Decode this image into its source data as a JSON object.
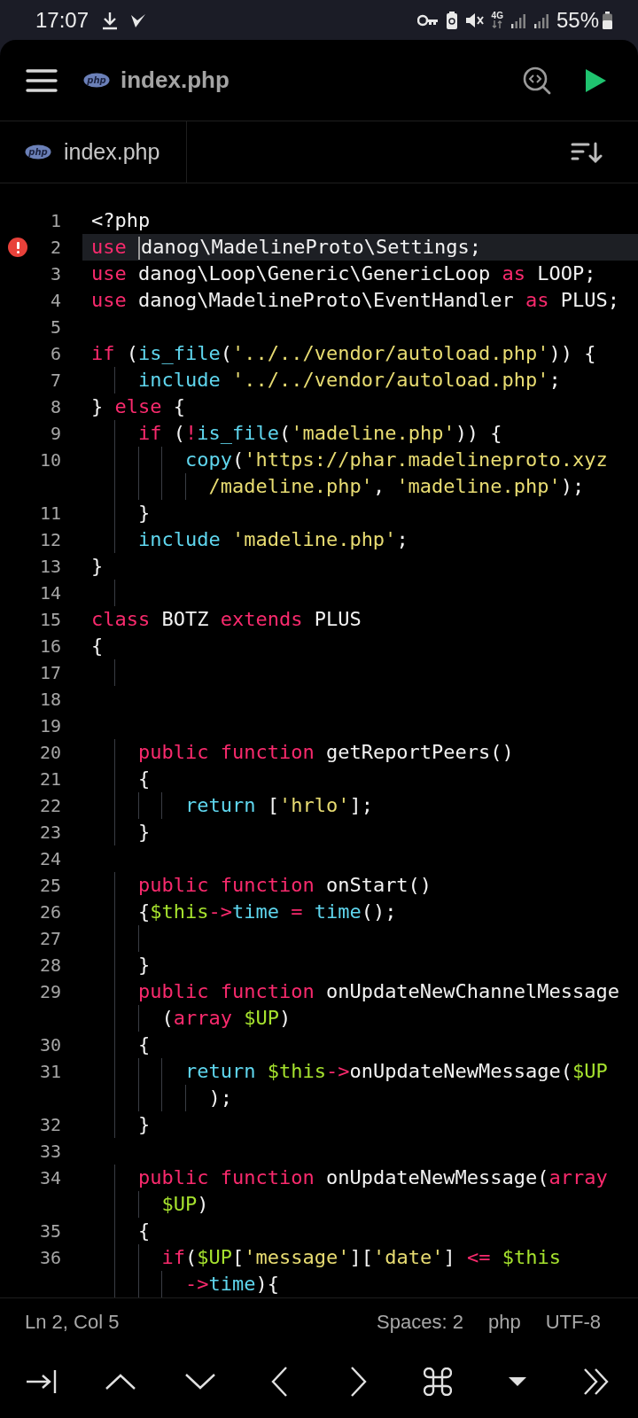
{
  "phone_status": {
    "time": "17:07",
    "network": "4G",
    "battery": "55%"
  },
  "toolbar": {
    "file_badge": "php",
    "title": "index.php"
  },
  "tabs": [
    {
      "badge": "php",
      "label": "index.php",
      "selected": true
    }
  ],
  "editor": {
    "lines": [
      {
        "number": "1",
        "rows": [
          {
            "tokens": [
              {
                "kind": "plain",
                "text": "<?php"
              }
            ]
          }
        ]
      },
      {
        "number": "2",
        "error": true,
        "current": true,
        "rows": [
          {
            "tokens": [
              {
                "kind": "keyword",
                "text": "use "
              },
              {
                "kind": "plain",
                "text": "danog\\MadelineProto\\Settings;",
                "cursor_before": true
              }
            ]
          }
        ]
      },
      {
        "number": "3",
        "rows": [
          {
            "tokens": [
              {
                "kind": "keyword",
                "text": "use "
              },
              {
                "kind": "plain",
                "text": "danog\\Loop\\Generic\\GenericLoop "
              },
              {
                "kind": "keyword",
                "text": "as"
              },
              {
                "kind": "plain",
                "text": " LOOP;"
              }
            ]
          }
        ]
      },
      {
        "number": "4",
        "rows": [
          {
            "tokens": [
              {
                "kind": "keyword",
                "text": "use "
              },
              {
                "kind": "plain",
                "text": "danog\\MadelineProto\\EventHandler "
              },
              {
                "kind": "keyword",
                "text": "as"
              },
              {
                "kind": "plain",
                "text": " PLUS;"
              }
            ]
          }
        ]
      },
      {
        "number": "5"
      },
      {
        "number": "6",
        "rows": [
          {
            "tokens": [
              {
                "kind": "keyword",
                "text": "if"
              },
              {
                "kind": "plain",
                "text": " ("
              },
              {
                "kind": "function",
                "text": "is_file"
              },
              {
                "kind": "plain",
                "text": "("
              },
              {
                "kind": "string",
                "text": "'../../vendor/autoload.php'"
              },
              {
                "kind": "plain",
                "text": ")) {"
              }
            ]
          }
        ]
      },
      {
        "number": "7",
        "rows": [
          {
            "indent": "    ",
            "tokens": [
              {
                "kind": "function",
                "text": "include"
              },
              {
                "kind": "string",
                "text": " '../../vendor/autoload.php'"
              },
              {
                "kind": "plain",
                "text": ";"
              }
            ]
          }
        ]
      },
      {
        "number": "8",
        "rows": [
          {
            "tokens": [
              {
                "kind": "plain",
                "text": "} "
              },
              {
                "kind": "keyword",
                "text": "else"
              },
              {
                "kind": "plain",
                "text": " {"
              }
            ]
          }
        ]
      },
      {
        "number": "9",
        "rows": [
          {
            "indent": "    ",
            "tokens": [
              {
                "kind": "keyword",
                "text": "if"
              },
              {
                "kind": "plain",
                "text": " ("
              },
              {
                "kind": "keyword",
                "text": "!"
              },
              {
                "kind": "function",
                "text": "is_file"
              },
              {
                "kind": "plain",
                "text": "("
              },
              {
                "kind": "string",
                "text": "'madeline.php'"
              },
              {
                "kind": "plain",
                "text": ")) {"
              }
            ]
          }
        ]
      },
      {
        "number": "10",
        "rows": [
          {
            "indent": "        ",
            "tokens": [
              {
                "kind": "function",
                "text": "copy"
              },
              {
                "kind": "plain",
                "text": "("
              },
              {
                "kind": "string",
                "text": "'https://phar.madelineproto.xyz"
              }
            ]
          },
          {
            "indent": "          ",
            "tokens": [
              {
                "kind": "string",
                "text": "/madeline.php'"
              },
              {
                "kind": "plain",
                "text": ", "
              },
              {
                "kind": "string",
                "text": "'madeline.php'"
              },
              {
                "kind": "plain",
                "text": ");"
              }
            ]
          }
        ]
      },
      {
        "number": "11",
        "rows": [
          {
            "indent": "    ",
            "tokens": [
              {
                "kind": "plain",
                "text": "}"
              }
            ]
          }
        ]
      },
      {
        "number": "12",
        "rows": [
          {
            "indent": "    ",
            "tokens": [
              {
                "kind": "function",
                "text": "include"
              },
              {
                "kind": "string",
                "text": " 'madeline.php'"
              },
              {
                "kind": "plain",
                "text": ";"
              }
            ]
          }
        ]
      },
      {
        "number": "13",
        "rows": [
          {
            "tokens": [
              {
                "kind": "plain",
                "text": "}"
              }
            ]
          }
        ]
      },
      {
        "number": "14",
        "rows": [
          {
            "indent": "    "
          }
        ]
      },
      {
        "number": "15",
        "rows": [
          {
            "tokens": [
              {
                "kind": "keyword",
                "text": "class"
              },
              {
                "kind": "plain",
                "text": " BOTZ "
              },
              {
                "kind": "keyword",
                "text": "extends"
              },
              {
                "kind": "plain",
                "text": " PLUS"
              }
            ]
          }
        ]
      },
      {
        "number": "16",
        "rows": [
          {
            "tokens": [
              {
                "kind": "plain",
                "text": "{"
              }
            ]
          }
        ]
      },
      {
        "number": "17",
        "rows": [
          {
            "indent": "    "
          }
        ]
      },
      {
        "number": "18"
      },
      {
        "number": "19"
      },
      {
        "number": "20",
        "rows": [
          {
            "indent": "    ",
            "tokens": [
              {
                "kind": "keyword",
                "text": "public function"
              },
              {
                "kind": "plain",
                "text": " getReportPeers()"
              }
            ]
          }
        ]
      },
      {
        "number": "21",
        "rows": [
          {
            "indent": "    ",
            "tokens": [
              {
                "kind": "plain",
                "text": "{"
              }
            ]
          }
        ]
      },
      {
        "number": "22",
        "rows": [
          {
            "indent": "        ",
            "tokens": [
              {
                "kind": "function",
                "text": "return"
              },
              {
                "kind": "plain",
                "text": " ["
              },
              {
                "kind": "string",
                "text": "'hrlo'"
              },
              {
                "kind": "plain",
                "text": "];"
              }
            ]
          }
        ]
      },
      {
        "number": "23",
        "rows": [
          {
            "indent": "    ",
            "tokens": [
              {
                "kind": "plain",
                "text": "}"
              }
            ]
          }
        ]
      },
      {
        "number": "24"
      },
      {
        "number": "25",
        "rows": [
          {
            "indent": "    ",
            "tokens": [
              {
                "kind": "keyword",
                "text": "public function"
              },
              {
                "kind": "plain",
                "text": " onStart()"
              }
            ]
          }
        ]
      },
      {
        "number": "26",
        "rows": [
          {
            "indent": "    ",
            "tokens": [
              {
                "kind": "plain",
                "text": "{"
              },
              {
                "kind": "variable",
                "text": "$this"
              },
              {
                "kind": "keyword",
                "text": "->"
              },
              {
                "kind": "function",
                "text": "time"
              },
              {
                "kind": "keyword",
                "text": " = "
              },
              {
                "kind": "function",
                "text": "time"
              },
              {
                "kind": "plain",
                "text": "();"
              }
            ]
          }
        ]
      },
      {
        "number": "27",
        "rows": [
          {
            "indent": "      "
          }
        ]
      },
      {
        "number": "28",
        "rows": [
          {
            "indent": "    ",
            "tokens": [
              {
                "kind": "plain",
                "text": "}"
              }
            ]
          }
        ]
      },
      {
        "number": "29",
        "rows": [
          {
            "indent": "    ",
            "tokens": [
              {
                "kind": "keyword",
                "text": "public function"
              },
              {
                "kind": "plain",
                "text": " onUpdateNewChannelMessage"
              }
            ]
          },
          {
            "indent": "      ",
            "tokens": [
              {
                "kind": "plain",
                "text": "("
              },
              {
                "kind": "keyword",
                "text": "array "
              },
              {
                "kind": "variable",
                "text": "$UP"
              },
              {
                "kind": "plain",
                "text": ")"
              }
            ]
          }
        ]
      },
      {
        "number": "30",
        "rows": [
          {
            "indent": "    ",
            "tokens": [
              {
                "kind": "plain",
                "text": "{"
              }
            ]
          }
        ]
      },
      {
        "number": "31",
        "rows": [
          {
            "indent": "        ",
            "tokens": [
              {
                "kind": "function",
                "text": "return "
              },
              {
                "kind": "variable",
                "text": "$this"
              },
              {
                "kind": "keyword",
                "text": "->"
              },
              {
                "kind": "plain",
                "text": "onUpdateNewMessage("
              },
              {
                "kind": "variable",
                "text": "$UP"
              }
            ]
          },
          {
            "indent": "          ",
            "tokens": [
              {
                "kind": "plain",
                "text": ");"
              }
            ]
          }
        ]
      },
      {
        "number": "32",
        "rows": [
          {
            "indent": "    ",
            "tokens": [
              {
                "kind": "plain",
                "text": "}"
              }
            ]
          }
        ]
      },
      {
        "number": "33"
      },
      {
        "number": "34",
        "rows": [
          {
            "indent": "    ",
            "tokens": [
              {
                "kind": "keyword",
                "text": "public function"
              },
              {
                "kind": "plain",
                "text": " onUpdateNewMessage("
              },
              {
                "kind": "keyword",
                "text": "array"
              }
            ]
          },
          {
            "indent": "      ",
            "tokens": [
              {
                "kind": "variable",
                "text": "$UP"
              },
              {
                "kind": "plain",
                "text": ")"
              }
            ]
          }
        ]
      },
      {
        "number": "35",
        "rows": [
          {
            "indent": "    ",
            "tokens": [
              {
                "kind": "plain",
                "text": "{"
              }
            ]
          }
        ]
      },
      {
        "number": "36",
        "rows": [
          {
            "indent": "      ",
            "tokens": [
              {
                "kind": "keyword",
                "text": "if"
              },
              {
                "kind": "plain",
                "text": "("
              },
              {
                "kind": "variable",
                "text": "$UP"
              },
              {
                "kind": "plain",
                "text": "["
              },
              {
                "kind": "string",
                "text": "'message'"
              },
              {
                "kind": "plain",
                "text": "]["
              },
              {
                "kind": "string",
                "text": "'date'"
              },
              {
                "kind": "plain",
                "text": "] "
              },
              {
                "kind": "keyword",
                "text": "<= "
              },
              {
                "kind": "variable",
                "text": "$this"
              }
            ]
          },
          {
            "indent": "        ",
            "tokens": [
              {
                "kind": "keyword",
                "text": "->"
              },
              {
                "kind": "function",
                "text": "time"
              },
              {
                "kind": "plain",
                "text": "){"
              }
            ]
          }
        ]
      }
    ]
  },
  "status_bar": {
    "position": "Ln 2, Col 5",
    "indentation": "Spaces: 2",
    "language": "php",
    "encoding": "UTF-8"
  },
  "extra_keys": [
    {
      "kind": "tab"
    },
    {
      "kind": "up"
    },
    {
      "kind": "down"
    },
    {
      "kind": "left"
    },
    {
      "kind": "right"
    },
    {
      "kind": "command"
    },
    {
      "kind": "dropdown"
    },
    {
      "kind": "more"
    }
  ]
}
